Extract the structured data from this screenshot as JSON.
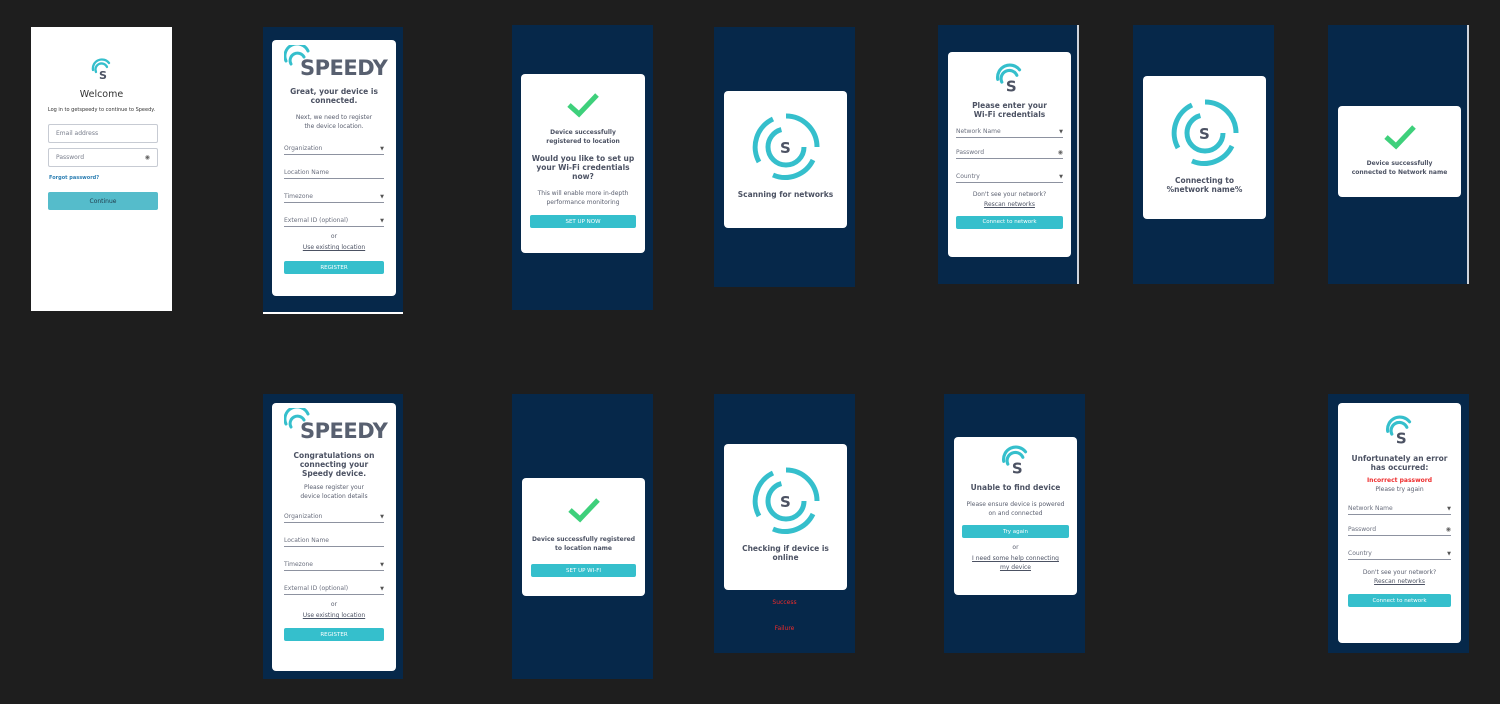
{
  "brand": {
    "name": "SPEEDY",
    "logo_letter": "S",
    "accent": "#35bfcc",
    "dark_bg": "#06284a"
  },
  "login": {
    "title": "Welcome",
    "subtitle": "Log in to getspeedy to continue to Speedy.",
    "email_placeholder": "Email address",
    "password_placeholder": "Password",
    "forgot": "Forgot password?",
    "continue": "Continue"
  },
  "register1": {
    "title": "Great, your device is connected.",
    "subtitle": "Next, we need to register the device location.",
    "organization": "Organization",
    "location_name": "Location Name",
    "timezone": "Timezone",
    "external_id": "External ID (optional)",
    "or": "or",
    "use_existing": "Use existing location",
    "register": "REGISTER"
  },
  "registered_prompt": {
    "message": "Device successfully registered to location",
    "question": "Would you like to set up your Wi-Fi credentials now?",
    "note": "This will enable more in-depth performance monitoring",
    "button": "SET UP NOW"
  },
  "scanning": {
    "label": "Scanning for networks"
  },
  "wifi_form": {
    "title": "Please enter your Wi-Fi credentials",
    "network_name": "Network Name",
    "password": "Password",
    "country": "Country",
    "dont_see": "Don't see your network?",
    "rescan": "Rescan networks",
    "connect": "Connect to network"
  },
  "connecting": {
    "label": "Connecting to %network name%"
  },
  "connected": {
    "message": "Device successfully connected to Network name"
  },
  "register2": {
    "title": "Congratulations on connecting your Speedy device.",
    "subtitle": "Please register your device location details",
    "organization": "Organization",
    "location_name": "Location Name",
    "timezone": "Timezone",
    "external_id": "External ID (optional)",
    "or": "or",
    "use_existing": "Use existing location",
    "register": "REGISTER"
  },
  "registered_name": {
    "message": "Device successfully registered to location name",
    "button": "SET UP WI-FI"
  },
  "checking": {
    "label": "Checking if device is online",
    "success": "Success",
    "failure": "Failure"
  },
  "not_found": {
    "title": "Unable to find device",
    "message": "Please ensure device is powered on and connected",
    "try_again": "Try again",
    "or": "or",
    "help": "I need some help connecting my device"
  },
  "error": {
    "title": "Unfortunately an error has occurred:",
    "detail": "Incorrect password",
    "retry": "Please try again",
    "network_name": "Network Name",
    "password": "Password",
    "country": "Country",
    "dont_see": "Don't see your network?",
    "rescan": "Rescan networks",
    "connect": "Connect to network"
  }
}
